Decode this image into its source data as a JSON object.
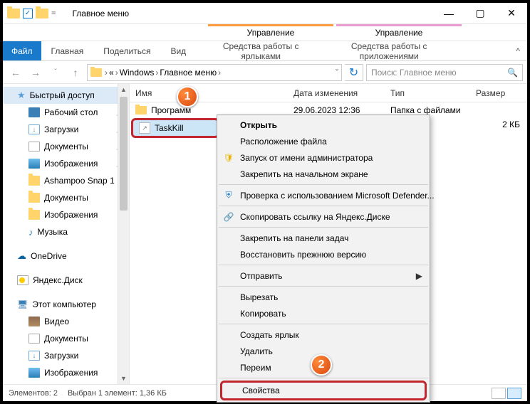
{
  "window": {
    "title": "Главное меню"
  },
  "ribbon": {
    "file": "Файл",
    "home": "Главная",
    "share": "Поделиться",
    "view": "Вид",
    "ctx1_top": "Управление",
    "ctx1_sub": "Средства работы с ярлыками",
    "ctx2_top": "Управление",
    "ctx2_sub": "Средства работы с приложениями"
  },
  "breadcrumb": {
    "seg1": "«",
    "seg2": "Windows",
    "seg3": "Главное меню"
  },
  "search": {
    "placeholder": "Поиск: Главное меню"
  },
  "sidebar": {
    "quick": "Быстрый доступ",
    "desktop": "Рабочий стол",
    "downloads": "Загрузки",
    "documents": "Документы",
    "pictures": "Изображения",
    "ashampoo": "Ashampoo Snap 1",
    "documents2": "Документы",
    "pictures2": "Изображения",
    "music": "Музыка",
    "onedrive": "OneDrive",
    "ydisk": "Яндекс.Диск",
    "thispc": "Этот компьютер",
    "video": "Видео",
    "documents3": "Документы",
    "downloads2": "Загрузки",
    "pictures3": "Изображения"
  },
  "columns": {
    "name": "Имя",
    "date": "Дата изменения",
    "type": "Тип",
    "size": "Размер"
  },
  "files": {
    "row0": {
      "name": "Программ",
      "date": "29.06.2023 12:36",
      "type": "Папка с файлами",
      "size": ""
    },
    "row1": {
      "name": "TaskKill",
      "size": "2 КБ"
    }
  },
  "context": {
    "open": "Открыть",
    "filelocation": "Расположение файла",
    "runasadmin": "Запуск от имени администратора",
    "pinstart": "Закрепить на начальном экране",
    "defender": "Проверка с использованием Microsoft Defender...",
    "yandexcopy": "Скопировать ссылку на Яндекс.Диске",
    "pintaskbar": "Закрепить на панели задач",
    "restoreprev": "Восстановить прежнюю версию",
    "sendto": "Отправить",
    "cut": "Вырезать",
    "copy": "Копировать",
    "shortcut": "Создать ярлык",
    "delete": "Удалить",
    "rename": "Переим",
    "properties": "Свойства"
  },
  "status": {
    "count": "Элементов: 2",
    "sel": "Выбран 1 элемент: 1,36 КБ"
  },
  "badges": {
    "b1": "1",
    "b2": "2"
  },
  "icons": {
    "shield": "🛡",
    "defender": "⛨",
    "link": "🔗",
    "chevron_r": "▶",
    "chevron_d": "ˇ",
    "refresh": "↻",
    "search": "🔍",
    "left": "←",
    "right": "→",
    "up": "↑",
    "check": "✓",
    "min": "—",
    "max": "▢",
    "close": "✕",
    "collapse": "^",
    "star": "★",
    "music": "♪",
    "cloud": "☁",
    "pc": "🖥"
  }
}
